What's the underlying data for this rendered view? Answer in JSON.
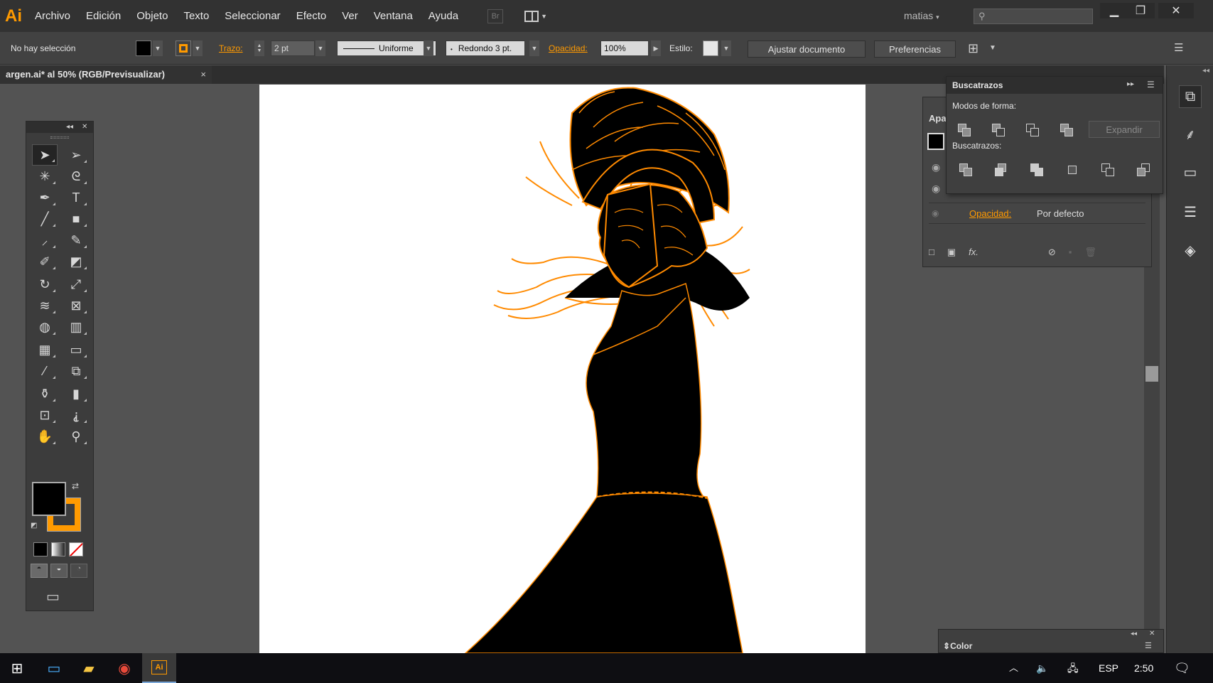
{
  "app": {
    "logo": "Ai",
    "accent_color": "#ff9a00"
  },
  "menu": {
    "items": [
      "Archivo",
      "Edición",
      "Objeto",
      "Texto",
      "Seleccionar",
      "Efecto",
      "Ver",
      "Ventana",
      "Ayuda"
    ],
    "bridge_label": "Br",
    "user": "matias",
    "search_placeholder": ""
  },
  "control_bar": {
    "selection_status": "No hay selección",
    "fill_color": "#000000",
    "stroke_color": "#ff9a00",
    "stroke_label": "Trazo:",
    "stroke_weight": "2 pt",
    "variable_width": "Uniforme",
    "brush": "Redondo 3 pt.",
    "opacity_label": "Opacidad:",
    "opacity_value": "100%",
    "style_label": "Estilo:",
    "adjust_document": "Ajustar documento",
    "preferences": "Preferencias"
  },
  "document": {
    "tab_title": "argen.ai* al 50% (RGB/Previsualizar)",
    "close_glyph": "×"
  },
  "tools": {
    "rows": [
      [
        "selection-tool",
        "direct-selection-tool"
      ],
      [
        "magic-wand-tool",
        "lasso-tool"
      ],
      [
        "pen-tool",
        "type-tool"
      ],
      [
        "line-segment-tool",
        "rectangle-tool"
      ],
      [
        "paintbrush-tool",
        "pencil-tool"
      ],
      [
        "blob-brush-tool",
        "eraser-tool"
      ],
      [
        "rotate-tool",
        "scale-tool"
      ],
      [
        "width-tool",
        "free-transform-tool"
      ],
      [
        "shape-builder-tool",
        "perspective-grid-tool"
      ],
      [
        "mesh-tool",
        "gradient-tool"
      ],
      [
        "eyedropper-tool",
        "blend-tool"
      ],
      [
        "symbol-sprayer-tool",
        "column-graph-tool"
      ],
      [
        "artboard-tool",
        "slice-tool"
      ],
      [
        "hand-tool",
        "zoom-tool"
      ]
    ],
    "glyphs": {
      "selection-tool": "➤",
      "direct-selection-tool": "➢",
      "magic-wand-tool": "✳",
      "lasso-tool": "ᘓ",
      "pen-tool": "✒",
      "type-tool": "T",
      "line-segment-tool": "╱",
      "rectangle-tool": "■",
      "paintbrush-tool": "⸝",
      "pencil-tool": "✎",
      "blob-brush-tool": "✐",
      "eraser-tool": "◩",
      "rotate-tool": "↻",
      "scale-tool": "⤢",
      "width-tool": "≋",
      "free-transform-tool": "⊠",
      "shape-builder-tool": "◍",
      "perspective-grid-tool": "▥",
      "mesh-tool": "▦",
      "gradient-tool": "▭",
      "eyedropper-tool": "⁄",
      "blend-tool": "⧉",
      "symbol-sprayer-tool": "⚱",
      "column-graph-tool": "▮",
      "artboard-tool": "⊡",
      "slice-tool": "⸘",
      "hand-tool": "✋",
      "zoom-tool": "⚲"
    }
  },
  "buscatrazos": {
    "title": "Buscatrazos",
    "shape_modes_label": "Modos de forma:",
    "pathfinders_label": "Buscatrazos:",
    "expand_button": "Expandir"
  },
  "apariencia": {
    "tab_label": "Apa",
    "opacity_label": "Opacidad:",
    "opacity_value": "Por defecto"
  },
  "color_panel": {
    "tab_label": "Color"
  },
  "taskbar": {
    "language": "ESP",
    "time": "2:50"
  }
}
